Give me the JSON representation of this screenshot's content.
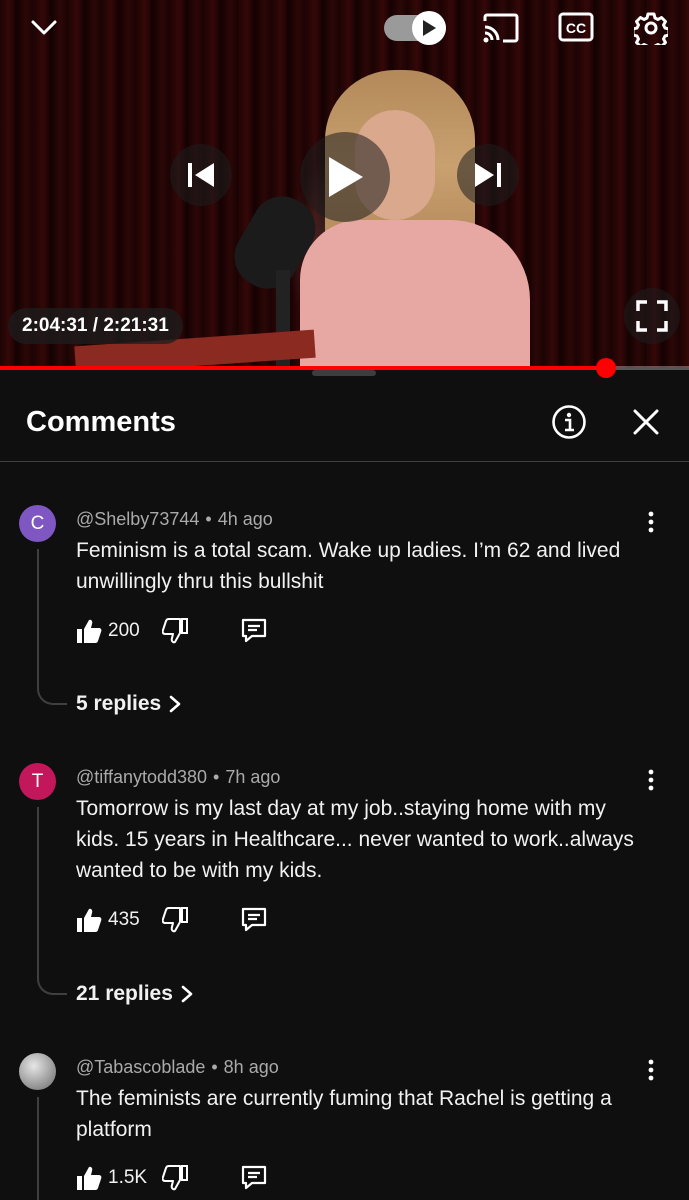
{
  "player": {
    "time_display": "2:04:31 / 2:21:31",
    "progress_fraction": 0.88,
    "autoplay_on": true,
    "cc_label": "CC",
    "icons": [
      "chevron-down-icon",
      "autoplay-toggle",
      "cast-icon",
      "cc-icon",
      "settings-gear-icon",
      "previous-icon",
      "play-icon",
      "next-icon",
      "fullscreen-icon"
    ]
  },
  "comments_panel": {
    "title": "Comments",
    "icons": [
      "info-icon",
      "close-icon"
    ]
  },
  "comments": [
    {
      "avatar_letter": "C",
      "avatar_color": "#7e57c2",
      "author": "@Shelby73744",
      "time": "4h ago",
      "text": "Feminism is a total scam. Wake up ladies. I’m 62 and lived unwillingly thru this bullshit",
      "likes": "200",
      "replies": "5 replies"
    },
    {
      "avatar_letter": "T",
      "avatar_color": "#c2185b",
      "author": "@tiffanytodd380",
      "time": "7h ago",
      "text": "Tomorrow is my last day at my job..staying home with my kids. 15 years in Healthcare... never wanted to work..always wanted to be with my kids.",
      "likes": "435",
      "replies": "21 replies"
    },
    {
      "avatar_letter": "",
      "avatar_color": "#9a9a9a",
      "author": "@Tabascoblade",
      "time": "8h ago",
      "text": "The feminists are currently fuming that Rachel is getting a platform",
      "likes": "1.5K",
      "replies": ""
    }
  ],
  "colors": {
    "background": "#0f0f0f",
    "progress": "#ff0000",
    "meta_text": "#aaaaaa"
  }
}
